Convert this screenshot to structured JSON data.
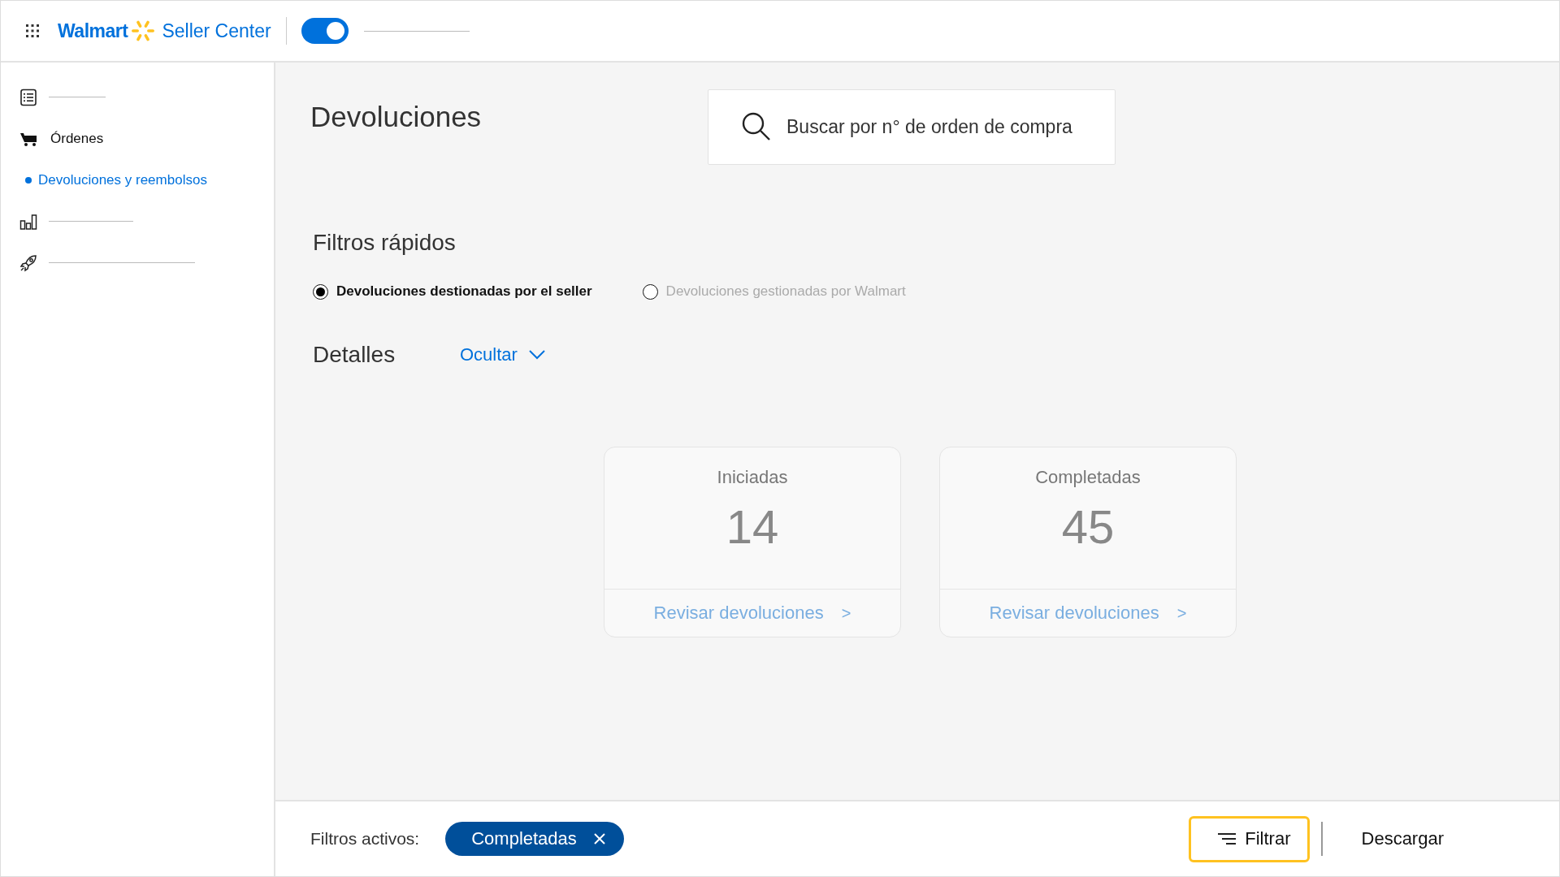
{
  "header": {
    "brand": "Walmart",
    "product": "Seller Center",
    "toggle": {
      "on": true
    }
  },
  "sidebar": {
    "items": [
      {
        "kind": "placeholder"
      },
      {
        "kind": "link",
        "label": "Órdenes",
        "selected": false
      },
      {
        "kind": "subitem",
        "label": "Devoluciones y reembolsos",
        "selected": true
      },
      {
        "kind": "placeholder"
      },
      {
        "kind": "placeholder"
      }
    ]
  },
  "page": {
    "title": "Devoluciones",
    "search": {
      "placeholder": "Buscar por n° de orden de compra"
    },
    "quick_filters": {
      "title": "Filtros rápidos",
      "options": [
        {
          "label": "Devoluciones destionadas por el seller",
          "selected": true
        },
        {
          "label": "Devoluciones gestionadas por Walmart",
          "selected": false
        }
      ]
    },
    "details": {
      "title": "Detalles",
      "toggle_label": "Ocultar",
      "expanded": true
    },
    "cards": [
      {
        "label": "Iniciadas",
        "value": "14",
        "link": "Revisar devoluciones",
        "arrow": ">"
      },
      {
        "label": "Completadas",
        "value": "45",
        "link": "Revisar devoluciones",
        "arrow": ">"
      }
    ]
  },
  "footer": {
    "label": "Filtros activos:",
    "chips": [
      {
        "label": "Completadas"
      }
    ],
    "buttons": [
      {
        "kind": "filter",
        "label": "Filtrar",
        "focused": true
      },
      {
        "kind": "plain",
        "label": "Descargar",
        "focused": false
      }
    ]
  }
}
